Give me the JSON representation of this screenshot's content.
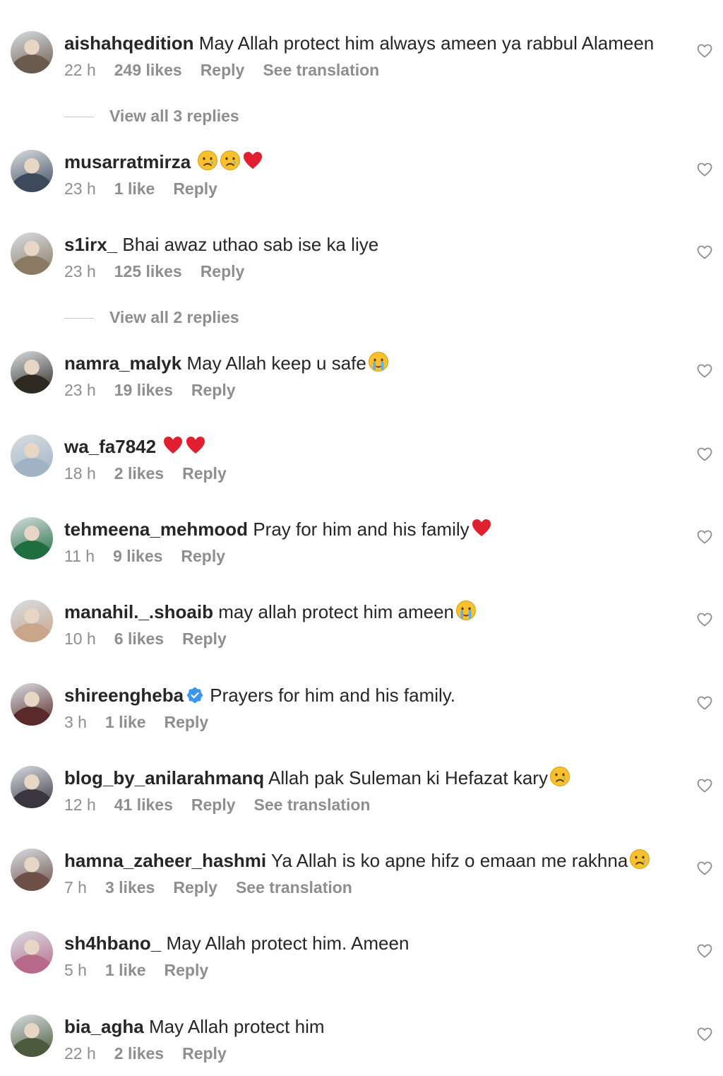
{
  "comments": [
    {
      "username": "aishahqedition",
      "text": "May Allah protect him always ameen ya rabbul Alameen",
      "emojis": [],
      "time": "22 h",
      "likes": "249 likes",
      "reply": "Reply",
      "translate": "See translation"
    },
    {
      "username": "musarratmirza",
      "text": "",
      "emojis": [
        "sad",
        "sad",
        "heart"
      ],
      "time": "23 h",
      "likes": "1 like",
      "reply": "Reply",
      "translate": ""
    },
    {
      "username": "s1irx_",
      "text": "Bhai awaz uthao sab ise ka liye",
      "emojis": [],
      "time": "23 h",
      "likes": "125 likes",
      "reply": "Reply",
      "translate": ""
    },
    {
      "username": "namra_malyk",
      "text": "May Allah keep u safe",
      "emojis": [
        "cry"
      ],
      "time": "23 h",
      "likes": "19 likes",
      "reply": "Reply",
      "translate": ""
    },
    {
      "username": "wa_fa7842",
      "text": "",
      "emojis": [
        "heart",
        "heart"
      ],
      "time": "18 h",
      "likes": "2 likes",
      "reply": "Reply",
      "translate": ""
    },
    {
      "username": "tehmeena_mehmood",
      "text": "Pray for him and his family",
      "emojis": [
        "heart"
      ],
      "time": "11 h",
      "likes": "9 likes",
      "reply": "Reply",
      "translate": ""
    },
    {
      "username": "manahil._.shoaib",
      "text": "may allah protect him ameen",
      "emojis": [
        "cry"
      ],
      "time": "10 h",
      "likes": "6 likes",
      "reply": "Reply",
      "translate": ""
    },
    {
      "username": "shireengheba",
      "text": "Prayers for him and his family.",
      "emojis": [],
      "verified": true,
      "time": "3 h",
      "likes": "1 like",
      "reply": "Reply",
      "translate": ""
    },
    {
      "username": "blog_by_anilarahmanq",
      "text": "Allah pak Suleman ki Hefazat kary",
      "emojis": [
        "sad"
      ],
      "time": "12 h",
      "likes": "41 likes",
      "reply": "Reply",
      "translate": "See translation"
    },
    {
      "username": "hamna_zaheer_hashmi",
      "text": "Ya Allah is ko apne hifz o emaan me rakhna",
      "emojis": [
        "sad"
      ],
      "time": "7 h",
      "likes": "3 likes",
      "reply": "Reply",
      "translate": "See translation"
    },
    {
      "username": "sh4hbano_",
      "text": "May Allah protect him. Ameen",
      "emojis": [],
      "time": "5 h",
      "likes": "1 like",
      "reply": "Reply",
      "translate": ""
    },
    {
      "username": "bia_agha",
      "text": "May Allah protect him",
      "emojis": [],
      "time": "22 h",
      "likes": "2 likes",
      "reply": "Reply",
      "translate": ""
    }
  ],
  "view_replies": [
    {
      "after_index": 0,
      "label": "View all 3 replies"
    },
    {
      "after_index": 2,
      "label": "View all 2 replies"
    }
  ],
  "avatar_colors": [
    "#6b5a4e",
    "#3d4a5c",
    "#8a7a64",
    "#2e2a22",
    "#9fb3c4",
    "#1f6e3e",
    "#c9a58c",
    "#5a2a2a",
    "#3a3640",
    "#6e5048",
    "#b86a8a",
    "#4a5a3a"
  ]
}
